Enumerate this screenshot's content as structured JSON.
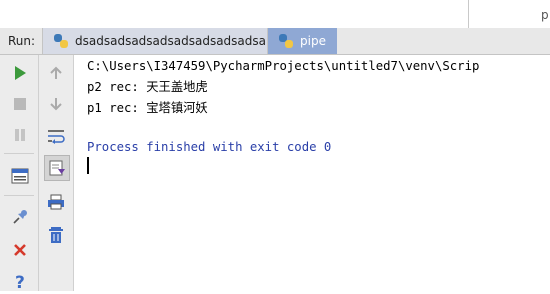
{
  "top": {
    "partial_text": "p"
  },
  "run_bar": {
    "label": "Run:",
    "tabs": [
      {
        "label": "dsadsadsadsadsadsadsadsadsa",
        "icon": "python-icon",
        "active": false
      },
      {
        "label": "pipe",
        "icon": "python-icon",
        "active": true
      }
    ]
  },
  "toolbar_left": [
    "rerun-icon",
    "stop-icon",
    "pause-icon",
    "layout-icon",
    "pin-icon",
    "close-icon",
    "help-icon"
  ],
  "toolbar_second": [
    "up-arrow-icon",
    "down-arrow-icon",
    "soft-wrap-icon",
    "scroll-to-end-icon",
    "print-icon",
    "trash-icon"
  ],
  "console": {
    "command": "C:\\Users\\I347459\\PycharmProjects\\untitled7\\venv\\Scrip",
    "lines": [
      "p2 rec: 天王盖地虎",
      "p1 rec: 宝塔镇河妖"
    ],
    "finished": "Process finished with exit code 0"
  },
  "colors": {
    "accent_tab": "#8fa8d4",
    "run_green": "#3c9a3c",
    "close_red": "#d53a2c",
    "finished_blue": "#2a3fa8"
  }
}
